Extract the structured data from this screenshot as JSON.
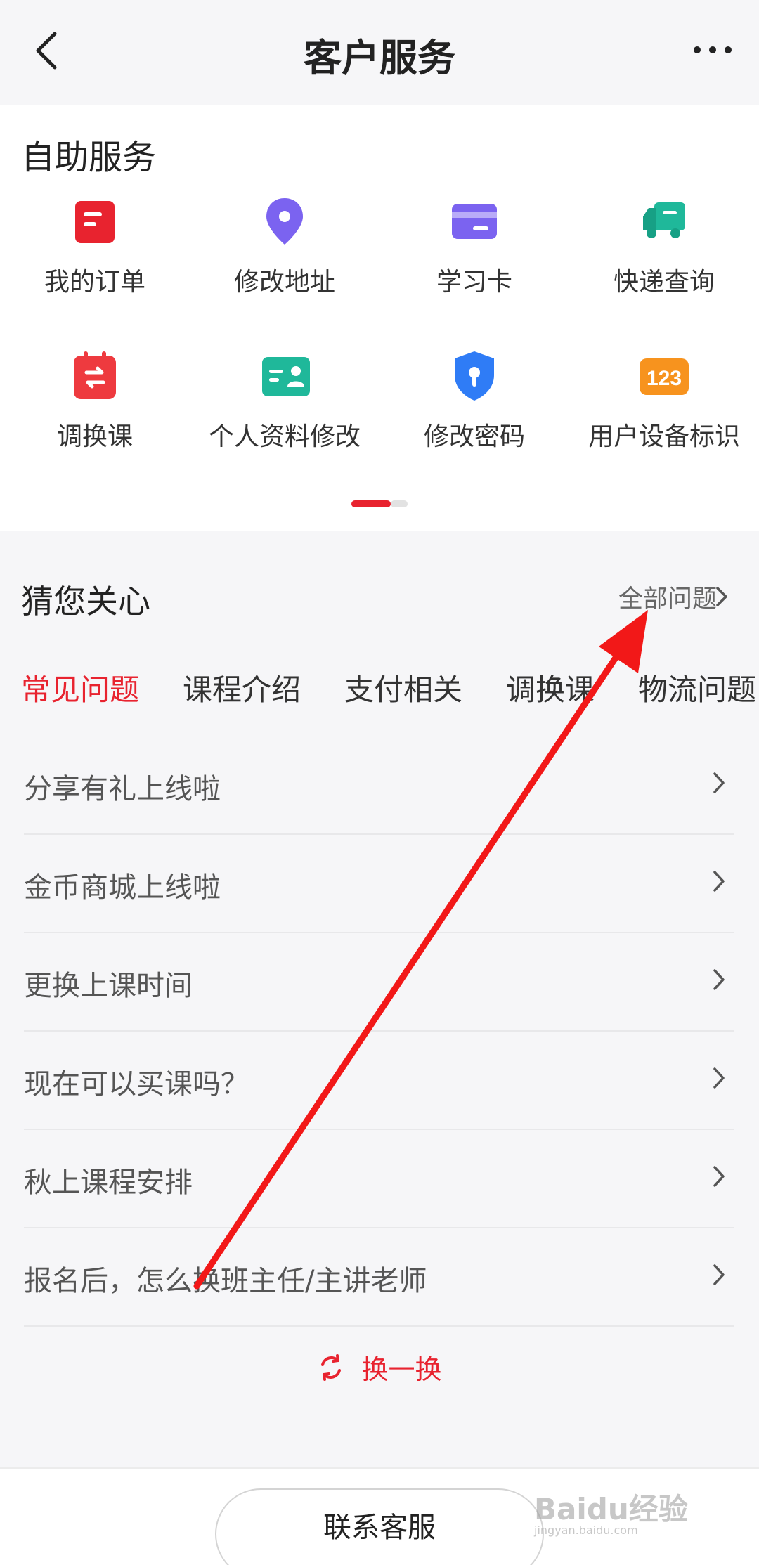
{
  "header": {
    "title": "客户服务"
  },
  "self_service": {
    "title": "自助服务",
    "items": [
      {
        "label": "我的订单",
        "icon": "order-icon"
      },
      {
        "label": "修改地址",
        "icon": "location-pin-icon"
      },
      {
        "label": "学习卡",
        "icon": "card-icon"
      },
      {
        "label": "快递查询",
        "icon": "truck-icon"
      },
      {
        "label": "调换课",
        "icon": "calendar-swap-icon"
      },
      {
        "label": "个人资料修改",
        "icon": "id-card-icon"
      },
      {
        "label": "修改密码",
        "icon": "shield-lock-icon"
      },
      {
        "label": "用户设备标识",
        "icon": "number-badge-icon",
        "badge_text": "123"
      }
    ]
  },
  "care": {
    "title": "猜您关心",
    "all_label": "全部问题",
    "tabs": [
      "常见问题",
      "课程介绍",
      "支付相关",
      "调换课",
      "物流问题"
    ],
    "questions": [
      "分享有礼上线啦",
      "金币商城上线啦",
      "更换上课时间",
      "现在可以买课吗？",
      "秋上课程安排",
      "报名后，怎么换班主任/主讲老师"
    ],
    "swap_label": "换一换"
  },
  "bottom": {
    "contact_label": "联系客服"
  },
  "watermark": {
    "brand": "Baidu经验",
    "url": "jingyan.baidu.com"
  },
  "colors": {
    "accent": "#e8232f",
    "background": "#f6f6f8"
  }
}
